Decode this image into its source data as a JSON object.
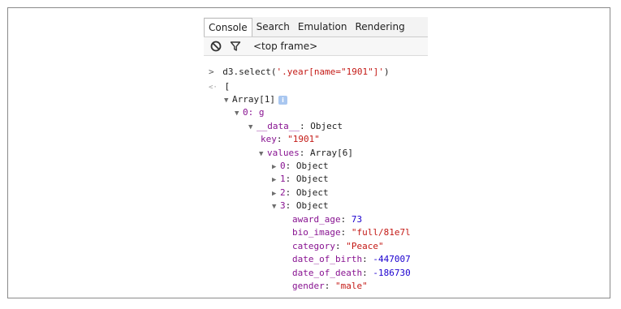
{
  "tabs": [
    {
      "label": "Console",
      "active": true
    },
    {
      "label": "Search",
      "active": false
    },
    {
      "label": "Emulation",
      "active": false
    },
    {
      "label": "Rendering",
      "active": false
    }
  ],
  "toolbar": {
    "clear_icon": "no-entry-icon",
    "filter_icon": "funnel-icon",
    "frame_label": "<top frame>"
  },
  "console": {
    "input_prompt": ">",
    "input_prefix": "d3.select(",
    "input_string": "'.year[name=\"1901\"]'",
    "input_suffix": ")",
    "result_glyph": "<·",
    "result_open": "[",
    "array_label": "Array[1]",
    "info_badge": "i",
    "item0_key": "0",
    "item0_value": "g",
    "data_key": "__data__",
    "data_value": "Object",
    "key_name": "key",
    "key_value": "\"1901\"",
    "values_name": "values",
    "values_value": "Array[6]",
    "entries": [
      {
        "index": "0",
        "value": "Object",
        "expanded": false
      },
      {
        "index": "1",
        "value": "Object",
        "expanded": false
      },
      {
        "index": "2",
        "value": "Object",
        "expanded": false
      },
      {
        "index": "3",
        "value": "Object",
        "expanded": true
      }
    ],
    "props": [
      {
        "name": "award_age",
        "value": "73",
        "kind": "num"
      },
      {
        "name": "bio_image",
        "value": "\"full/81e7l",
        "kind": "str"
      },
      {
        "name": "category",
        "value": "\"Peace\"",
        "kind": "str"
      },
      {
        "name": "date_of_birth",
        "value": "-447007",
        "kind": "num"
      },
      {
        "name": "date_of_death",
        "value": "-186730",
        "kind": "num"
      },
      {
        "name": "gender",
        "value": "\"male\"",
        "kind": "str"
      }
    ]
  }
}
